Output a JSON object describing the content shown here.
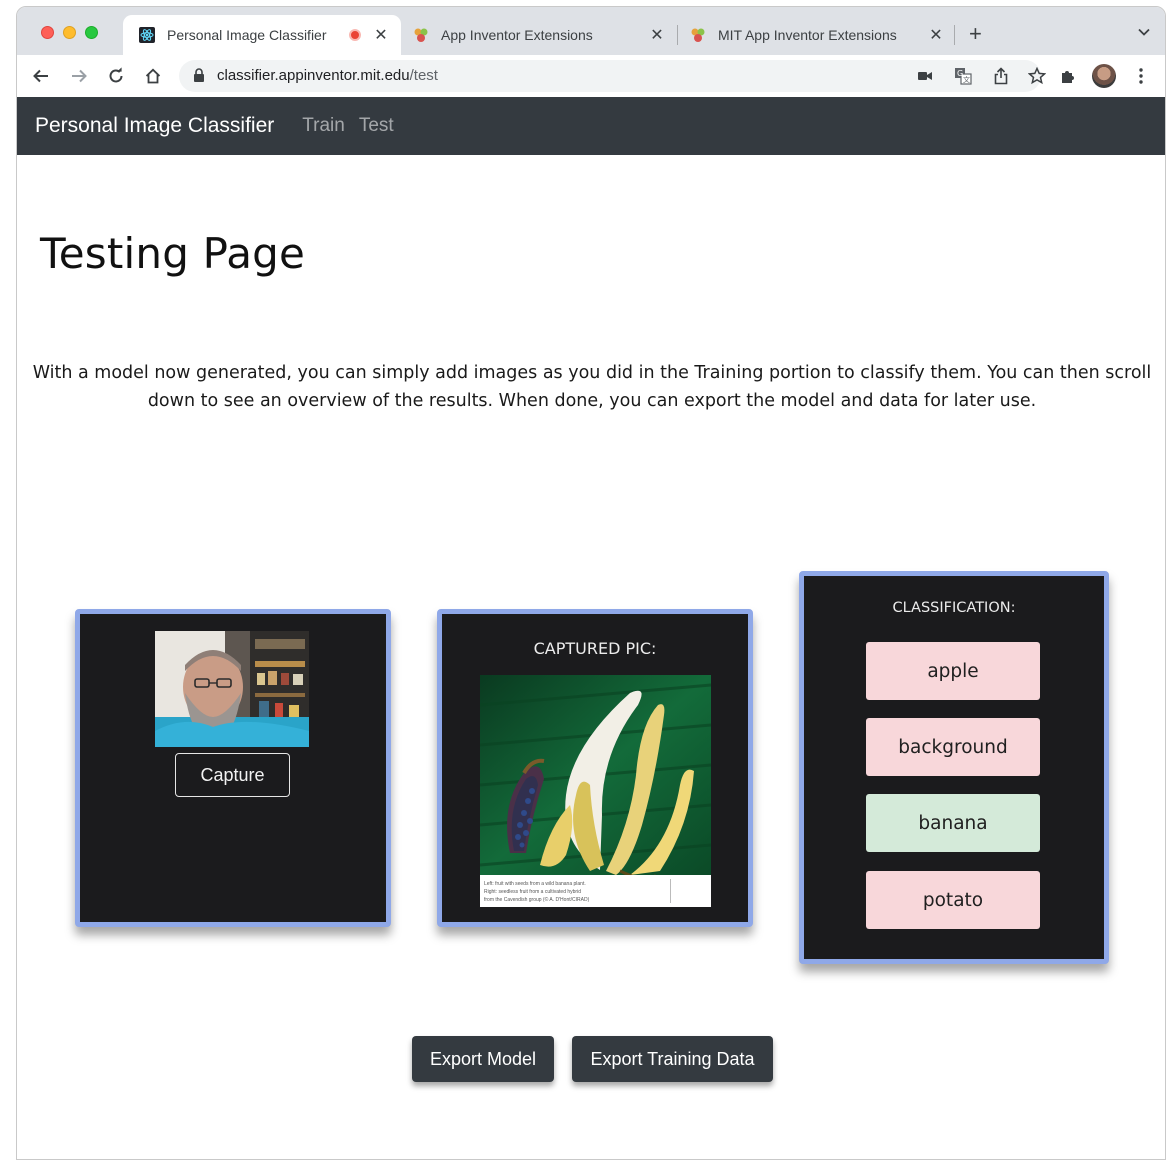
{
  "browser": {
    "tabs": [
      {
        "title": "Personal Image Classifier",
        "active": true,
        "recording": true
      },
      {
        "title": "App Inventor Extensions",
        "active": false
      },
      {
        "title": "MIT App Inventor Extensions",
        "active": false
      }
    ],
    "new_tab_symbol": "+",
    "url": {
      "domain": "classifier.appinventor.mit.edu",
      "path": "/test"
    },
    "icons": [
      "back-icon",
      "forward-icon",
      "reload-icon",
      "home-icon",
      "lock-icon",
      "camera-icon",
      "translate-icon",
      "share-icon",
      "star-icon",
      "extensions-icon",
      "profile-avatar",
      "menu-icon"
    ]
  },
  "navbar": {
    "brand": "Personal Image Classifier",
    "links": [
      "Train",
      "Test"
    ]
  },
  "page": {
    "title": "Testing Page",
    "intro": "With a model now generated, you can simply add images as you did in the Training portion to classify them. You can then scroll down to see an overview of the results. When done, you can export the model and data for later use."
  },
  "webcam": {
    "capture_label": "Capture"
  },
  "captured": {
    "label": "CAPTURED PIC:",
    "caption_lines": [
      "Left: fruit with seeds from a wild banana plant.",
      "Right: seedless fruit from a cultivated hybrid",
      "from the Cavendish group (© A. D'Hont/CIRAD)"
    ]
  },
  "classification": {
    "label": "CLASSIFICATION:",
    "classes": [
      {
        "name": "apple",
        "selected": false
      },
      {
        "name": "background",
        "selected": false
      },
      {
        "name": "banana",
        "selected": true
      },
      {
        "name": "potato",
        "selected": false
      }
    ]
  },
  "export": {
    "model_label": "Export Model",
    "data_label": "Export Training Data"
  },
  "colors": {
    "navbar_bg": "#343a40",
    "card_border": "#8fa8e8",
    "card_bg": "#1b1b1d",
    "class_negative": "#f8d7da",
    "class_positive": "#d4ead9"
  }
}
